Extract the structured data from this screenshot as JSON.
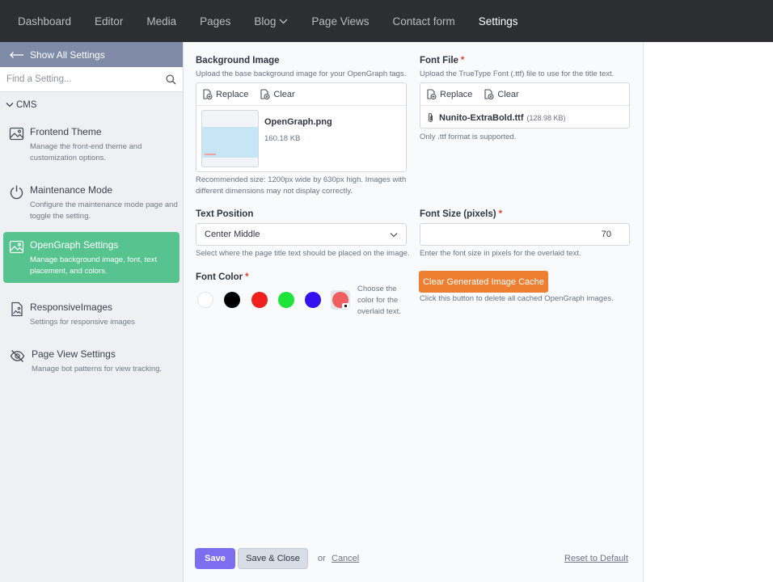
{
  "nav": {
    "items": [
      {
        "label": "Dashboard"
      },
      {
        "label": "Editor"
      },
      {
        "label": "Media"
      },
      {
        "label": "Pages"
      },
      {
        "label": "Blog"
      },
      {
        "label": "Page Views"
      },
      {
        "label": "Contact form"
      },
      {
        "label": "Settings"
      }
    ],
    "active": "Settings"
  },
  "sidebar": {
    "show_all": "Show All Settings",
    "search_placeholder": "Find a Setting...",
    "section": "CMS",
    "items": [
      {
        "title": "Frontend Theme",
        "desc": "Manage the front-end theme and customization options.",
        "icon": "image-icon"
      },
      {
        "title": "Maintenance Mode",
        "desc": "Configure the maintenance mode page and toggle the setting.",
        "icon": "power-icon"
      },
      {
        "title": "OpenGraph Settings",
        "desc": "Manage background image, font, text placement, and colors.",
        "icon": "image-icon",
        "active": true
      },
      {
        "title": "ResponsiveImages",
        "desc": "Settings for responsive images",
        "icon": "document-image-icon"
      },
      {
        "title": "Page View Settings",
        "desc": "Manage bot patterns for view tracking.",
        "icon": "eye-slash-icon"
      }
    ]
  },
  "form": {
    "bg_image": {
      "label": "Background Image",
      "hint": "Upload the base background image for your OpenGraph tags.",
      "replace": "Replace",
      "clear": "Clear",
      "file_name": "OpenGraph.png",
      "file_size": "160.18 KB",
      "note_line1": "Recommended size: 1200px wide by 630px high. Images with",
      "note_line2": "different dimensions may not display correctly."
    },
    "font_file": {
      "label": "Font File",
      "required": "*",
      "hint": "Upload the TrueType Font (.ttf) file to use for the title text.",
      "replace": "Replace",
      "clear": "Clear",
      "file_name": "Nunito-ExtraBold.ttf",
      "file_size": "(128.98 KB)",
      "note": "Only .ttf format is supported."
    },
    "text_position": {
      "label": "Text Position",
      "value": "Center Middle",
      "hint": "Select where the page title text should be placed on the image."
    },
    "font_size": {
      "label": "Font Size (pixels)",
      "required": "*",
      "value": "70",
      "hint": "Enter the font size in pixels for the overlaid text."
    },
    "font_color": {
      "label": "Font Color",
      "required": "*",
      "swatches": [
        "#ffffff",
        "#000000",
        "#f0201c",
        "#1ee43a",
        "#3310f0"
      ],
      "selected": "#ef5f5f",
      "hint_line1": "Choose the",
      "hint_line2": "color for the",
      "hint_line3": "overlaid text."
    },
    "cache": {
      "button": "Clear Generated Image Cache",
      "hint": "Click this button to delete all cached OpenGraph images."
    }
  },
  "footer": {
    "save": "Save",
    "save_close": "Save & Close",
    "or": "or",
    "cancel": "Cancel",
    "reset": "Reset to Default"
  },
  "colors": {
    "accent": "#57c490",
    "primary": "#7d6df0",
    "warning": "#ee7f31",
    "nav_bg": "#2c2e31"
  }
}
